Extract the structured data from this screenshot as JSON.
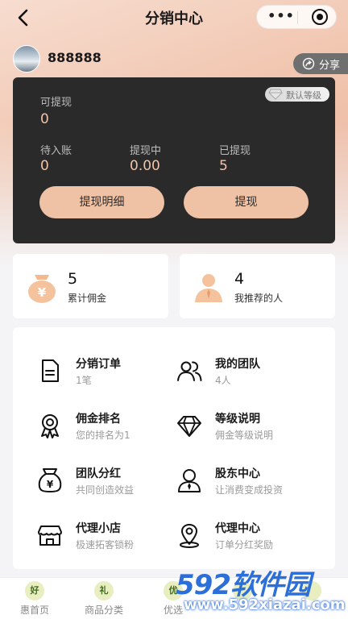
{
  "header": {
    "title": "分销中心",
    "more_label": "•••"
  },
  "user": {
    "name": "888888"
  },
  "share": {
    "label": "分享"
  },
  "wallet": {
    "level_badge": "默认等级",
    "withdrawable_label": "可提现",
    "withdrawable_value": "0",
    "pending_label": "待入账",
    "pending_value": "0",
    "withdrawing_label": "提现中",
    "withdrawing_value": "0.00",
    "withdrawn_label": "已提现",
    "withdrawn_value": "5",
    "detail_button": "提现明细",
    "withdraw_button": "提现"
  },
  "stats": {
    "commission": {
      "value": "5",
      "label": "累计佣金"
    },
    "referrals": {
      "value": "4",
      "label": "我推荐的人"
    }
  },
  "menu": [
    {
      "title": "分销订单",
      "subtitle": "1笔",
      "icon": "document-icon"
    },
    {
      "title": "我的团队",
      "subtitle": "4人",
      "icon": "team-icon"
    },
    {
      "title": "佣金排名",
      "subtitle": "您的排名为1",
      "icon": "medal-icon"
    },
    {
      "title": "等级说明",
      "subtitle": "佣金等级说明",
      "icon": "diamond-icon"
    },
    {
      "title": "团队分红",
      "subtitle": "共同创造效益",
      "icon": "money-bag-icon"
    },
    {
      "title": "股东中心",
      "subtitle": "让消费变成投资",
      "icon": "shareholder-icon"
    },
    {
      "title": "代理小店",
      "subtitle": "极速拓客锁粉",
      "icon": "shop-icon"
    },
    {
      "title": "代理中心",
      "subtitle": "订单分红奖励",
      "icon": "location-icon"
    }
  ],
  "tabbar": [
    {
      "label": "惠首页",
      "icon_text": "好"
    },
    {
      "label": "商品分类",
      "icon_text": "礼"
    },
    {
      "label": "优选",
      "icon_text": "优"
    },
    {
      "label": "",
      "icon_text": ""
    },
    {
      "label": "",
      "icon_text": ""
    }
  ],
  "watermark": {
    "brand": "592软件园",
    "url": "www.592xiazai.com"
  },
  "colors": {
    "accent": "#f0c2a5",
    "card_dark": "#2a2a2a",
    "value_text": "#f1c3a8"
  }
}
